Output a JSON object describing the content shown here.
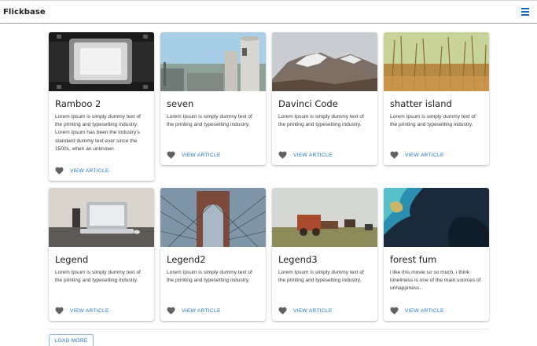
{
  "header": {
    "brand": "Flickbase",
    "menu_icon": "hamburger-menu-icon"
  },
  "colors": {
    "accent": "#1976d2",
    "menu": "#1565c0",
    "heart": "#616161"
  },
  "cards": [
    {
      "title": "Ramboo 2",
      "description": "Lorem Ipsum is simply dummy text of the printing and typesetting industry. Lorem Ipsum has been the industry's standard dummy text ever since the 1500s, when an unknown",
      "action": "VIEW ARTICLE",
      "image": "film-reel-photo"
    },
    {
      "title": "seven",
      "description": "Lorem Ipsum is simply dummy text of the printing and typesetting industry.",
      "action": "VIEW ARTICLE",
      "image": "industrial-silos-photo"
    },
    {
      "title": "Davinci Code",
      "description": "Lorem Ipsum is simply dummy text of the printing and typesetting industry.",
      "action": "VIEW ARTICLE",
      "image": "snowy-mountain-photo"
    },
    {
      "title": "shatter island",
      "description": "Lorem Ipsum is simply dummy text of the printing and typesetting industry.",
      "action": "VIEW ARTICLE",
      "image": "tall-grass-photo"
    },
    {
      "title": "Legend",
      "description": "Lorem Ipsum is simply dummy text of the printing and typesetting industry.",
      "action": "VIEW ARTICLE",
      "image": "laptop-desk-photo"
    },
    {
      "title": "Legend2",
      "description": "Lorem Ipsum is simply dummy text of the printing and typesetting industry.",
      "action": "VIEW ARTICLE",
      "image": "bridge-photo"
    },
    {
      "title": "Legend3",
      "description": "Lorem Ipsum is simply dummy text of the printing and typesetting industry.",
      "action": "VIEW ARTICLE",
      "image": "farm-wagon-photo"
    },
    {
      "title": "forest fum",
      "description": "i like this movie so so much, i think loneliness is one of the main sources of unhappiness..",
      "action": "VIEW ARTICLE",
      "image": "ocean-aerial-photo"
    }
  ],
  "load_more": "LOAD MORE"
}
